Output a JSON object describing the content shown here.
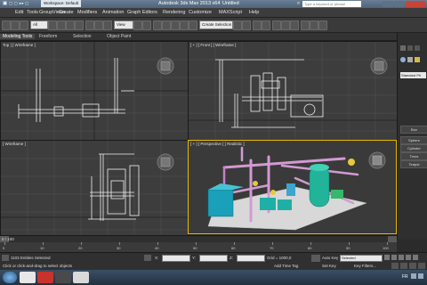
{
  "titlebar": {
    "workspace": "Workspace: Default",
    "app_title": "Autodesk 3ds Max  2013 x64",
    "document": "Untitled",
    "search_placeholder": "Type a keyword or phrase"
  },
  "menu": [
    "Edit",
    "Tools",
    "Group",
    "Views",
    "Create",
    "Modifiers",
    "Animation",
    "Graph Editors",
    "Rendering",
    "Customize",
    "MAXScript",
    "Help"
  ],
  "toolbar": {
    "selection_filter": "All",
    "view_dropdown": "View",
    "named_selection": "Create Selection Se"
  },
  "ribbon_tabs": [
    "Modeling Tools",
    "Freeform",
    "Selection",
    "Object Paint"
  ],
  "viewports": {
    "top": "Top ] [ Wireframe ]",
    "front": "[ + ] [ Front ] [ Wireframe ]",
    "left": "[ Wireframe ]",
    "perspective": "[ + ] [ Perspective ] [ Realistic ]"
  },
  "command_panel": {
    "category": "Standard Pri",
    "object_types": [
      "Box",
      "Sphere",
      "Cylinder",
      "Torus",
      "Teapot"
    ]
  },
  "timeline": {
    "frame_label": "0 / 100",
    "ticks": [
      "0",
      "10",
      "20",
      "30",
      "40",
      "50",
      "60",
      "70",
      "80",
      "90",
      "100"
    ]
  },
  "status": {
    "selection": "1103 Entities Selected",
    "prompt": "Click or click-and-drag to select objects",
    "coord_x_label": "X:",
    "coord_y_label": "Y:",
    "coord_z_label": "Z:",
    "grid": "Grid = 1000,0",
    "auto_key": "Auto Key",
    "key_mode": "Selected",
    "set_key": "Set Key",
    "key_filters": "Key Filters...",
    "add_time_tag": "Add Time Tag"
  },
  "taskbar": {
    "locale": "FR"
  }
}
